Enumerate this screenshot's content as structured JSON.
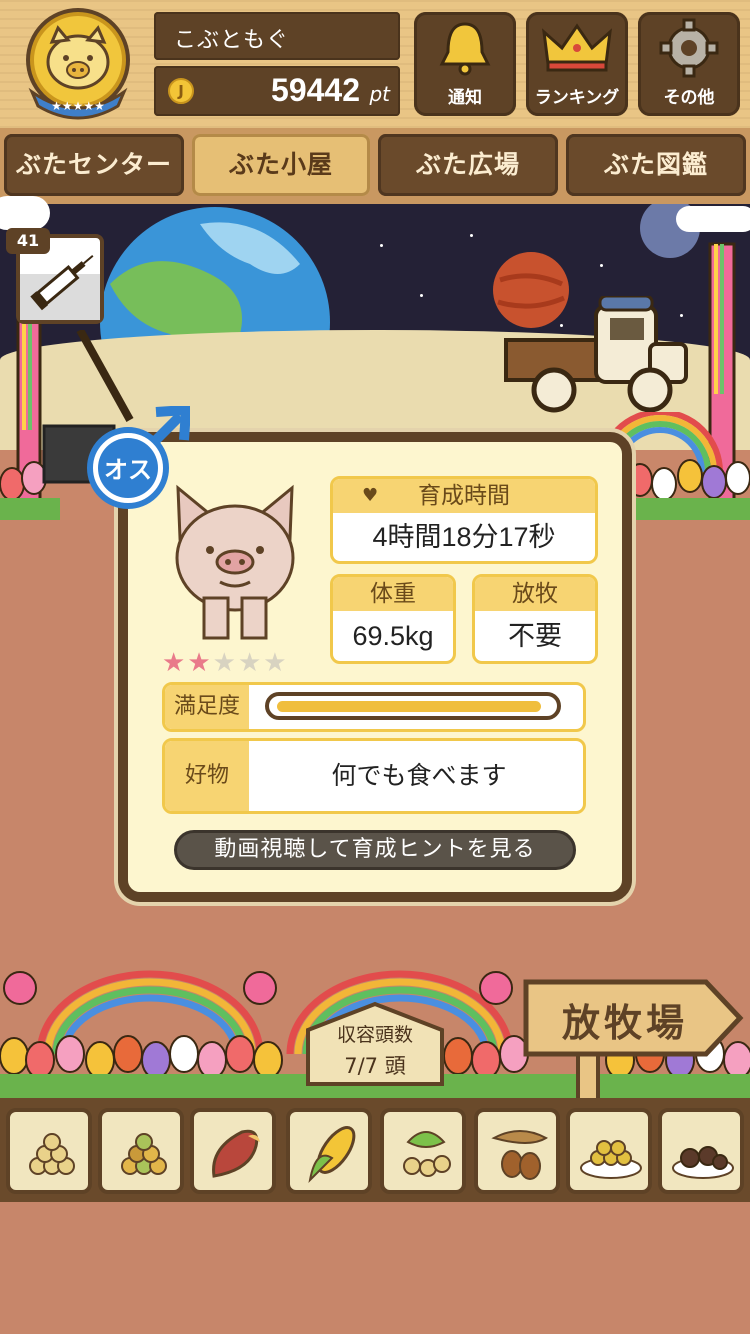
{
  "player": {
    "name": "こぶともぐ",
    "points": "59442",
    "points_unit": "pt",
    "coin_glyph": "J"
  },
  "top_buttons": [
    {
      "label": "通知",
      "icon": "bell-icon"
    },
    {
      "label": "ランキング",
      "icon": "crown-icon"
    },
    {
      "label": "その他",
      "icon": "gear-icon"
    }
  ],
  "tabs": [
    {
      "label": "ぶたセンター",
      "active": false
    },
    {
      "label": "ぶた小屋",
      "active": true
    },
    {
      "label": "ぶた広場",
      "active": false
    },
    {
      "label": "ぶた図鑑",
      "active": false
    }
  ],
  "injection": {
    "count": "41",
    "icon": "syringe-icon"
  },
  "pig": {
    "gender_label": "オス",
    "rarity_stars": 2,
    "rarity_max": 5,
    "raising_time_label": "育成時間",
    "raising_time_value": "4時間18分17秒",
    "weight_label": "体重",
    "weight_value": "69.5kg",
    "grazing_label": "放牧",
    "grazing_value": "不要",
    "satisfaction_label": "満足度",
    "satisfaction_level": 0.97,
    "favorite_label": "好物",
    "favorite_value": "何でも食べます",
    "hint_button": "動画視聴して育成ヒントを見る"
  },
  "capacity": {
    "title": "収容頭数",
    "value": "7/7 頭"
  },
  "pasture_sign": "放牧場",
  "foods": [
    {
      "icon": "grain-pile-icon"
    },
    {
      "icon": "mixed-grain-icon"
    },
    {
      "icon": "sweet-potato-icon"
    },
    {
      "icon": "corn-icon"
    },
    {
      "icon": "soybean-icon"
    },
    {
      "icon": "acorn-icon"
    },
    {
      "icon": "grain-plate-icon"
    },
    {
      "icon": "meatball-plate-icon"
    }
  ],
  "colors": {
    "wood_dark": "#5e4226",
    "wood_light": "#e9c585",
    "panel": "#fdf6cf",
    "accent_yellow": "#f7d472",
    "star_on": "#e97a8a",
    "gender_blue": "#2f7fd1"
  }
}
